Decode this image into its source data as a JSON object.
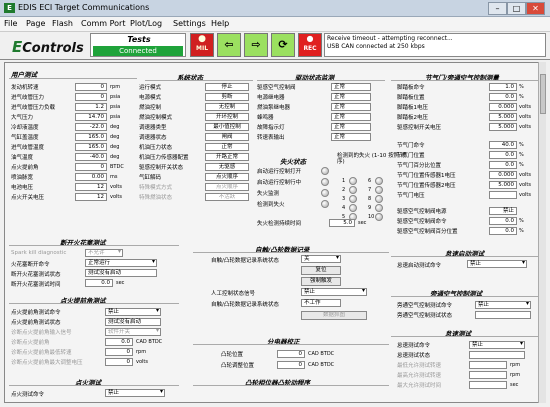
{
  "window": {
    "title": "EDIS ECI Target Communications",
    "icon_text": "E"
  },
  "menu": [
    "File",
    "Page",
    "Flash",
    "Comm Port",
    "Plot/Log",
    "Settings",
    "Help"
  ],
  "toolbar": {
    "logo": "Controls",
    "tests_label": "Tests",
    "connection_status": "Connected",
    "mil_label": "MIL",
    "rec_label": "REC",
    "messages": [
      "Receive timeout - attempting reconnect...",
      "USB CAN connected at 250 kbps"
    ]
  },
  "user_test": {
    "title": "用户测试",
    "rows": [
      {
        "label": "发动机转速",
        "value": "0",
        "unit": "rpm"
      },
      {
        "label": "进气歧管压力",
        "value": "0",
        "unit": "psia"
      },
      {
        "label": "进气歧管压力负载",
        "value": "1.2",
        "unit": "psia"
      },
      {
        "label": "大气压力",
        "value": "14.70",
        "unit": "psia"
      },
      {
        "label": "冷却液温度",
        "value": "-22.0",
        "unit": "deg"
      },
      {
        "label": "气缸盖温度",
        "value": "165.0",
        "unit": "deg"
      },
      {
        "label": "进气歧管温度",
        "value": "165.0",
        "unit": "deg"
      },
      {
        "label": "油气温度",
        "value": "-40.0",
        "unit": "deg"
      },
      {
        "label": "点火提前角",
        "value": "0",
        "unit": "BTDC"
      },
      {
        "label": "喷油脉宽",
        "value": "0.00",
        "unit": "ms"
      },
      {
        "label": "电池电压",
        "value": "12",
        "unit": "volts"
      },
      {
        "label": "点火开关电压",
        "value": "12",
        "unit": "volts"
      }
    ]
  },
  "system_status": {
    "title": "系统状态",
    "rows": [
      {
        "label": "运行模式",
        "value": "停止"
      },
      {
        "label": "电源模式",
        "value": "剪断"
      },
      {
        "label": "燃油控制",
        "value": "无控制"
      },
      {
        "label": "燃油控制模式",
        "value": "开环控制"
      },
      {
        "label": "调速器类型",
        "value": "最小值控制"
      },
      {
        "label": "调速器状态",
        "value": "闸阀"
      },
      {
        "label": "机油压力状态",
        "value": "正常"
      },
      {
        "label": "机油压力传感器配置",
        "value": "开路正常"
      },
      {
        "label": "驱感控制开关状态",
        "value": "无驱感"
      },
      {
        "label": "气缸解码",
        "value": "点火顺序"
      },
      {
        "label": "特殊模式方式",
        "value": "点火顺序"
      },
      {
        "label": "特殊燃油状态",
        "value": "不活跃"
      }
    ]
  },
  "drive_monitor": {
    "title": "驱动状态监测",
    "rows": [
      {
        "label": "驱感空气控制阀",
        "value": "正常"
      },
      {
        "label": "电源继电器",
        "value": "正常"
      },
      {
        "label": "燃油泵继电器",
        "value": "正常"
      },
      {
        "label": "蜂鸣器",
        "value": "正常"
      },
      {
        "label": "故障指示灯",
        "value": "正常"
      },
      {
        "label": "转速表输出",
        "value": "正常"
      }
    ]
  },
  "misfire": {
    "title": "失火状态",
    "rows": [
      "启动运行控制打开",
      "启动运行控制行中",
      "失火监测",
      "检测到失火"
    ],
    "cyl_title": "检测到的失火 (1-10 按照 顺序)",
    "cyls": [
      "1",
      "6",
      "2",
      "7",
      "3",
      "8",
      "4",
      "9",
      "5",
      "10"
    ],
    "threshold_label": "失火检测持续时间",
    "threshold_value": "5.0",
    "threshold_unit": "sec"
  },
  "throttle": {
    "title": "节气门/旁通空气控制测量",
    "rows": [
      {
        "label": "脚踏板命令",
        "value": "1.0",
        "unit": "%"
      },
      {
        "label": "脚踏板位置",
        "value": "0.0",
        "unit": "%"
      },
      {
        "label": "脚踏板1电压",
        "value": "0.000",
        "unit": "volts"
      },
      {
        "label": "脚踏板2电压",
        "value": "5.000",
        "unit": "volts"
      },
      {
        "label": "驱感控制开关电压",
        "value": "5.000",
        "unit": "volts"
      },
      {
        "label": "节气门命令",
        "value": "40.0",
        "unit": "%"
      },
      {
        "label": "节气门位置",
        "value": "0.0",
        "unit": "%"
      },
      {
        "label": "节气门百分比位置",
        "value": "0.0",
        "unit": "%"
      },
      {
        "label": "节气门位置传感器1电压",
        "value": "0.000",
        "unit": "volts"
      },
      {
        "label": "节气门位置传感器2电压",
        "value": "5.000",
        "unit": "volts"
      },
      {
        "label": "节气门电压",
        "value": "",
        "unit": "volts"
      },
      {
        "label": "驱感空气控制阀电源",
        "value": "禁止",
        "unit": ""
      },
      {
        "label": "驱感空气控制阀命令",
        "value": "0.0",
        "unit": "%"
      },
      {
        "label": "驱感空气控制阀百分位置",
        "value": "0.0",
        "unit": "%"
      }
    ]
  },
  "spark_kill": {
    "title": "断开火花塞测试",
    "diag_label": "Spark kill diagnostic",
    "diag_value": "不允许",
    "enable_label": "火花塞断开命令",
    "enable_value": "正常运行",
    "mode_label": "断开火花塞测试状态",
    "mode_value": "测试没有启动",
    "time_label": "断开火花塞测试时间",
    "time_value": "0.0",
    "time_unit": "sec"
  },
  "spark_advance": {
    "title": "点火提前角测试",
    "rows": [
      {
        "label": "点火提前角测试命令",
        "value": "禁止"
      },
      {
        "label": "点火提前角测试状态",
        "value": "测试没有启动"
      },
      {
        "label": "诊断点火提前角输入信号",
        "value": "软件开关"
      },
      {
        "label": "诊断点火提前角",
        "value": "0.0",
        "unit": "CAD BTDC"
      },
      {
        "label": "诊断点火提前角最低转速",
        "value": "0",
        "unit": "rpm"
      },
      {
        "label": "诊断点火提前角最大调整电压",
        "value": "0",
        "unit": "volts"
      }
    ]
  },
  "injector_test": {
    "title": "点火测试",
    "row_label": "点火测试命令",
    "row_value": "禁止"
  },
  "auto_record": {
    "title": "自触/凸轮数据记录",
    "mode_label": "自触/凸轮数据记录系统状态",
    "mode_value": "关",
    "reset_btn": "复位",
    "force_btn": "强制触发",
    "manual_label": "人工控制状态信号",
    "manual_value": "禁止",
    "status_label": "自触/凸轮数据记录系统状态",
    "status_value": "不工作",
    "capture_btn": "数据抓图"
  },
  "cam_test": {
    "title": "分电器校正",
    "rows": [
      {
        "label": "凸轮位置",
        "value": "0",
        "unit": "CAD BTDC"
      },
      {
        "label": "凸轮调整位置",
        "value": "0",
        "unit": "CAD BTDC"
      }
    ]
  },
  "cam_phasing": {
    "title": "凸轮相位器凸轮动程序"
  },
  "idle_test": {
    "title": "怠速启动测试",
    "row_label": "怠速启动测试命令",
    "row_value": "禁止"
  },
  "bypass_test": {
    "title": "旁通空气控制测试",
    "rows": [
      {
        "label": "旁通空气控制测试命令",
        "value": "禁止"
      },
      {
        "label": "旁通空气控制测试状态",
        "value": ""
      }
    ]
  },
  "fuel_test": {
    "title": "怠速测试",
    "rows": [
      {
        "label": "怠速测试命令",
        "value": "禁止"
      },
      {
        "label": "怠速测试状态",
        "value": ""
      },
      {
        "label": "最低允许测试转速",
        "value": "",
        "unit": "rpm"
      },
      {
        "label": "最高允许测试转速",
        "value": "",
        "unit": "rpm"
      },
      {
        "label": "最大允许测试时间",
        "value": "",
        "unit": "sec"
      }
    ]
  },
  "colors": {
    "connected": "#1fa33a",
    "mil": "#e02020",
    "arrows": "#9be060",
    "rec": "#e02020"
  }
}
